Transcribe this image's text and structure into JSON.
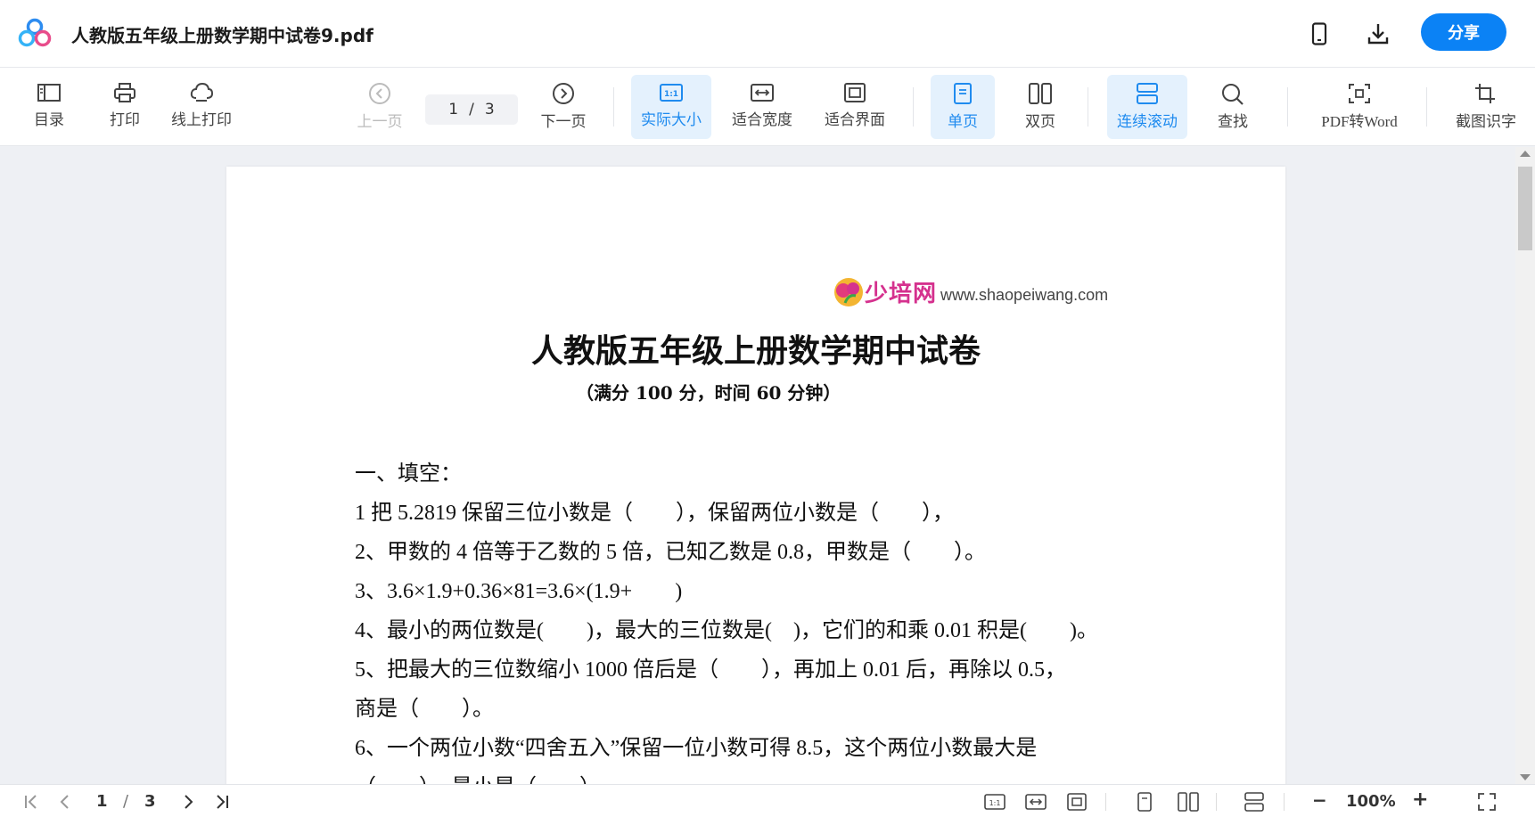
{
  "app": {
    "doc_title": "人教版五年级上册数学期中试卷9.pdf",
    "share_label": "分享",
    "brand_color": "#0b82f5",
    "active_color": "#1f8bef"
  },
  "titlebar_icons": [
    "mobile-icon",
    "download-icon"
  ],
  "toolbar": {
    "toc": "目录",
    "print": "打印",
    "online_print": "线上打印",
    "prev_page": "上一页",
    "page_current": "1",
    "page_sep": "/",
    "page_total": "3",
    "next_page": "下一页",
    "actual_size": "实际大小",
    "fit_width": "适合宽度",
    "fit_page": "适合界面",
    "single_page": "单页",
    "double_page": "双页",
    "continuous": "连续滚动",
    "find": "查找",
    "pdf_to_word": "PDF转Word",
    "ocr": "截图识字",
    "ratio_label": "1:1"
  },
  "document": {
    "brand_name": "少培网",
    "brand_url": "www.shaopeiwang.com",
    "title": "人教版五年级上册数学期中试卷",
    "subtitle": "（满分 100 分，时间 60 分钟）",
    "lines": [
      "一、填空：",
      "1 把 5.2819 保留三位小数是（　　），保留两位小数是（　　），",
      "2、甲数的 4 倍等于乙数的 5 倍，已知乙数是 0.8，甲数是（　　）。",
      "3、3.6×1.9+0.36×81=3.6×(1.9+　　)",
      "4、最小的两位数是(　　)，最大的三位数是(　)，它们的和乘 0.01 积是(　　)。",
      "5、把最大的三位数缩小 1000 倍后是（　　），再加上 0.01 后，再除以 0.5，",
      "商是（　　）。",
      "6、一个两位小数“四舍五入”保留一位小数可得 8.5，这个两位小数最大是",
      "（　　），最小是（　　）。"
    ]
  },
  "statusbar": {
    "page_current": "1",
    "page_sep": "/",
    "page_total": "3",
    "zoom": "100%",
    "zoom_out": "−",
    "zoom_in": "+"
  }
}
